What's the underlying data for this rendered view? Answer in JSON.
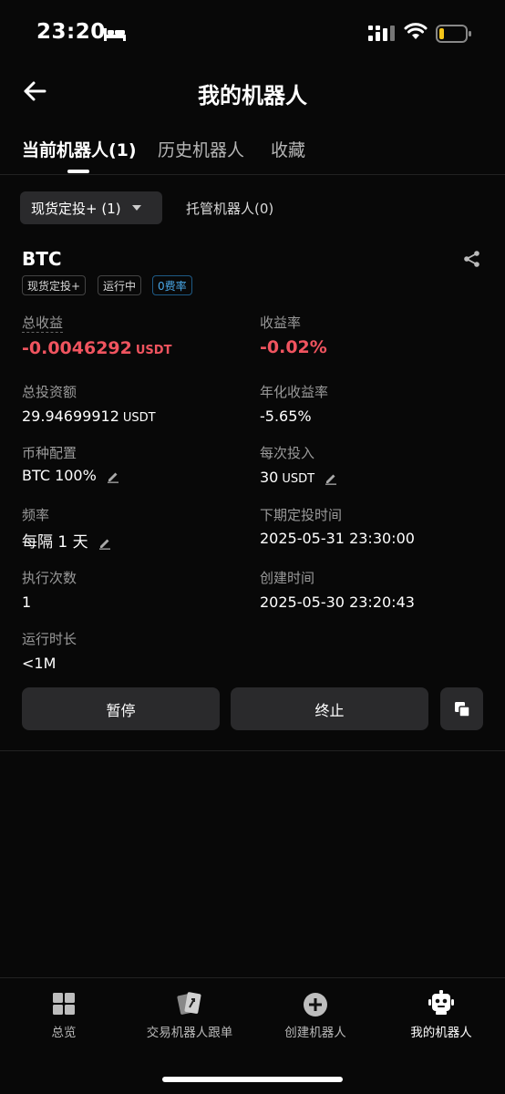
{
  "status": {
    "time": "23:20"
  },
  "header": {
    "title": "我的机器人"
  },
  "tabs": [
    {
      "label": "当前机器人(1)"
    },
    {
      "label": "历史机器人"
    },
    {
      "label": "收藏"
    }
  ],
  "filters": {
    "selected": "现货定投+ (1)",
    "managed": "托管机器人(0)"
  },
  "bot": {
    "coin": "BTC",
    "tags": [
      "现货定投+",
      "运行中",
      "0费率"
    ],
    "total_profit": {
      "label": "总收益",
      "value": "-0.0046292",
      "unit": "USDT"
    },
    "profit_rate": {
      "label": "收益率",
      "value": "-0.02%"
    },
    "total_invest": {
      "label": "总投资额",
      "value": "29.94699912",
      "unit": "USDT"
    },
    "annual_rate": {
      "label": "年化收益率",
      "value": "-5.65%"
    },
    "allocation": {
      "label": "币种配置",
      "value": "BTC 100%"
    },
    "per_invest": {
      "label": "每次投入",
      "value": "30",
      "unit": "USDT"
    },
    "frequency": {
      "label": "频率",
      "value": "每隔 1 天"
    },
    "next_time": {
      "label": "下期定投时间",
      "value": "2025-05-31 23:30:00"
    },
    "exec_count": {
      "label": "执行次数",
      "value": "1"
    },
    "created": {
      "label": "创建时间",
      "value": "2025-05-30 23:20:43"
    },
    "runtime": {
      "label": "运行时长",
      "value": "<1M"
    },
    "actions": {
      "pause": "暂停",
      "stop": "终止"
    }
  },
  "bottom_nav": [
    {
      "label": "总览",
      "icon": "grid-icon"
    },
    {
      "label": "交易机器人跟单",
      "icon": "cards-icon"
    },
    {
      "label": "创建机器人",
      "icon": "plus-circle-icon"
    },
    {
      "label": "我的机器人",
      "icon": "robot-icon"
    }
  ]
}
